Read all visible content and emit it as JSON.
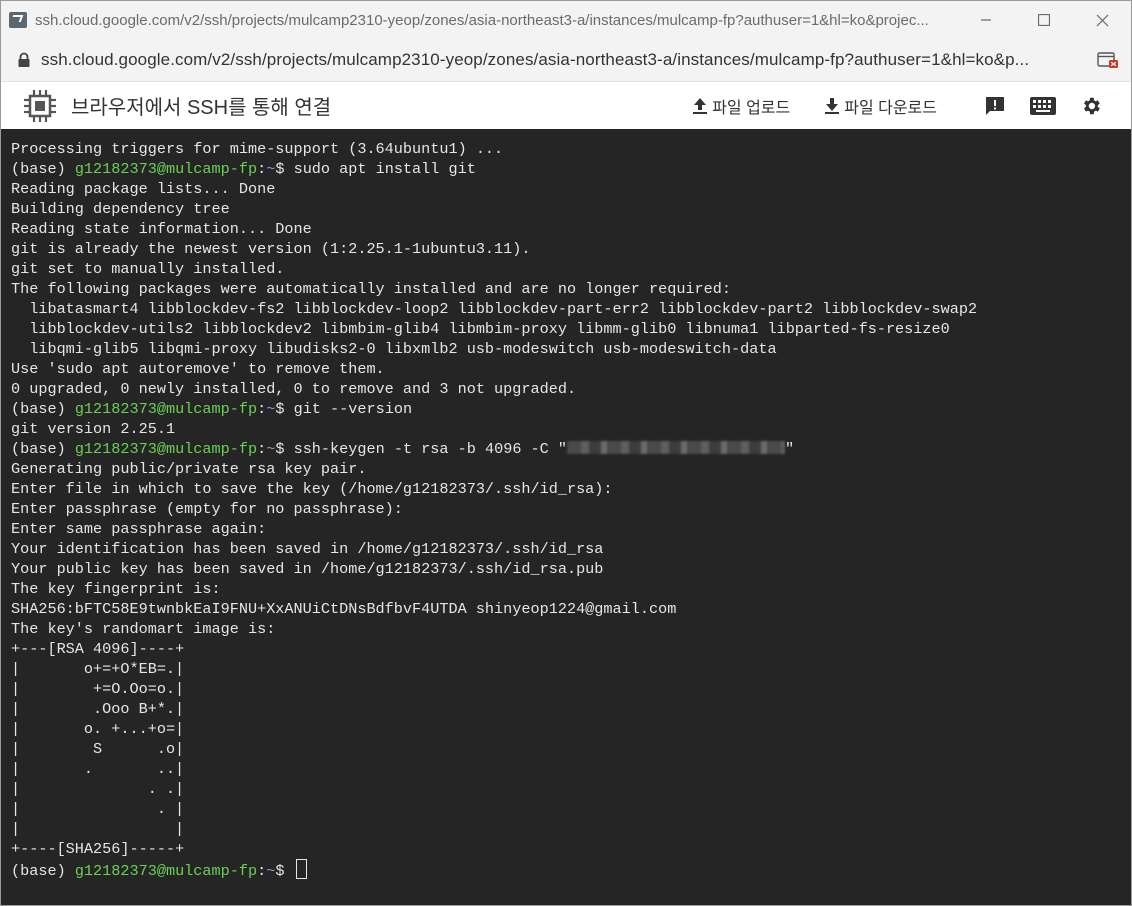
{
  "window": {
    "title": "ssh.cloud.google.com/v2/ssh/projects/mulcamp2310-yeop/zones/asia-northeast3-a/instances/mulcamp-fp?authuser=1&hl=ko&projec...",
    "minimize_icon": "minimize-icon",
    "maximize_icon": "maximize-icon",
    "close_icon": "close-icon"
  },
  "address": {
    "url": "ssh.cloud.google.com/v2/ssh/projects/mulcamp2310-yeop/zones/asia-northeast3-a/instances/mulcamp-fp?authuser=1&hl=ko&p..."
  },
  "appbar": {
    "title": "브라우저에서 SSH를 통해 연결",
    "upload_label": "파일 업로드",
    "download_label": "파일 다운로드",
    "icons": [
      "chip-icon",
      "feedback-icon",
      "keyboard-icon",
      "settings-icon"
    ]
  },
  "terminal": {
    "colors": {
      "background": "#252526",
      "text": "#e6e6e6",
      "user": "#6bd150",
      "path": "#6aa8e6"
    },
    "prompt": {
      "env": "(base) ",
      "user": "g12182373@mulcamp-fp",
      "sep": ":",
      "path": "~",
      "symbol": "$ "
    },
    "lines": [
      {
        "t": "text",
        "text": "Processing triggers for mime-support (3.64ubuntu1) ..."
      },
      {
        "t": "prompt",
        "cmd": "sudo apt install git"
      },
      {
        "t": "text",
        "text": "Reading package lists... Done"
      },
      {
        "t": "text",
        "text": "Building dependency tree"
      },
      {
        "t": "text",
        "text": "Reading state information... Done"
      },
      {
        "t": "text",
        "text": "git is already the newest version (1:2.25.1-1ubuntu3.11)."
      },
      {
        "t": "text",
        "text": "git set to manually installed."
      },
      {
        "t": "text",
        "text": "The following packages were automatically installed and are no longer required:"
      },
      {
        "t": "text",
        "text": "  libatasmart4 libblockdev-fs2 libblockdev-loop2 libblockdev-part-err2 libblockdev-part2 libblockdev-swap2"
      },
      {
        "t": "text",
        "text": "  libblockdev-utils2 libblockdev2 libmbim-glib4 libmbim-proxy libmm-glib0 libnuma1 libparted-fs-resize0"
      },
      {
        "t": "text",
        "text": "  libqmi-glib5 libqmi-proxy libudisks2-0 libxmlb2 usb-modeswitch usb-modeswitch-data"
      },
      {
        "t": "text",
        "text": "Use 'sudo apt autoremove' to remove them."
      },
      {
        "t": "text",
        "text": "0 upgraded, 0 newly installed, 0 to remove and 3 not upgraded."
      },
      {
        "t": "prompt",
        "cmd": "git --version"
      },
      {
        "t": "text",
        "text": "git version 2.25.1"
      },
      {
        "t": "prompt",
        "cmd": "ssh-keygen -t rsa -b 4096 -C \"",
        "redacted": true,
        "after": "\""
      },
      {
        "t": "text",
        "text": "Generating public/private rsa key pair."
      },
      {
        "t": "text",
        "text": "Enter file in which to save the key (/home/g12182373/.ssh/id_rsa):"
      },
      {
        "t": "text",
        "text": "Enter passphrase (empty for no passphrase):"
      },
      {
        "t": "text",
        "text": "Enter same passphrase again:"
      },
      {
        "t": "text",
        "text": "Your identification has been saved in /home/g12182373/.ssh/id_rsa"
      },
      {
        "t": "text",
        "text": "Your public key has been saved in /home/g12182373/.ssh/id_rsa.pub"
      },
      {
        "t": "text",
        "text": "The key fingerprint is:"
      },
      {
        "t": "text",
        "text": "SHA256:bFTC58E9twnbkEaI9FNU+XxANUiCtDNsBdfbvF4UTDA shinyeop1224@gmail.com"
      },
      {
        "t": "text",
        "text": "The key's randomart image is:"
      },
      {
        "t": "text",
        "text": "+---[RSA 4096]----+"
      },
      {
        "t": "text",
        "text": "|       o+=+O*EB=.|"
      },
      {
        "t": "text",
        "text": "|        +=O.Oo=o.|"
      },
      {
        "t": "text",
        "text": "|        .Ooo B+*.|"
      },
      {
        "t": "text",
        "text": "|       o. +...+o=|"
      },
      {
        "t": "text",
        "text": "|        S      .o|"
      },
      {
        "t": "text",
        "text": "|       .       ..|"
      },
      {
        "t": "text",
        "text": "|              . .|"
      },
      {
        "t": "text",
        "text": "|               . |"
      },
      {
        "t": "text",
        "text": "|                 |"
      },
      {
        "t": "text",
        "text": "+----[SHA256]-----+"
      },
      {
        "t": "prompt",
        "cmd": "",
        "cursor": true
      }
    ]
  }
}
